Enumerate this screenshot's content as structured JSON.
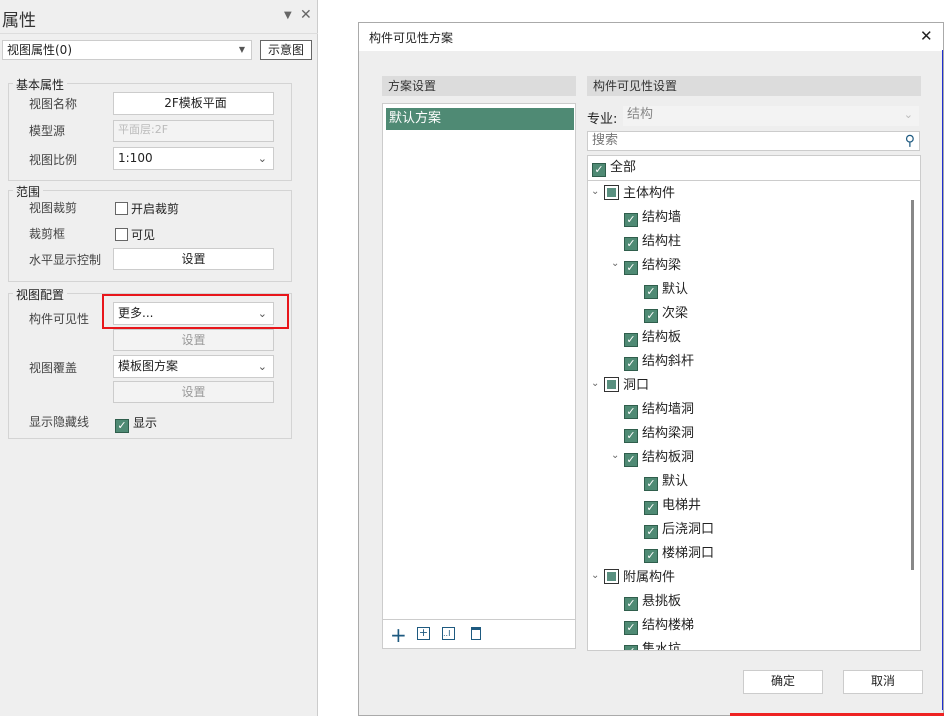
{
  "panel": {
    "title": "属性",
    "dropdown": "视图属性(0)",
    "preview_button": "示意图",
    "basic": {
      "title": "基本属性",
      "view_name_label": "视图名称",
      "view_name": "2F模板平面",
      "model_source_label": "模型源",
      "model_source": "平面层:2F",
      "scale_label": "视图比例",
      "scale": "1:100"
    },
    "range": {
      "title": "范围",
      "crop_label": "视图裁剪",
      "crop_check": "开启裁剪",
      "crop_box_label": "裁剪框",
      "crop_box_check": "可见",
      "horizontal_label": "水平显示控制",
      "horizontal_btn": "设置"
    },
    "config": {
      "title": "视图配置",
      "visibility_label": "构件可见性",
      "visibility_value": "更多...",
      "visibility_btn": "设置",
      "override_label": "视图覆盖",
      "override_value": "模板图方案",
      "override_btn": "设置",
      "hidden_label": "显示隐藏线",
      "hidden_check": "显示"
    }
  },
  "dialog": {
    "title": "构件可见性方案",
    "scheme_header": "方案设置",
    "schemes": [
      "默认方案"
    ],
    "visibility_header": "构件可见性设置",
    "discipline_label": "专业:",
    "discipline": "结构",
    "search_placeholder": "搜索",
    "all_label": "全部",
    "tree": [
      {
        "label": "主体构件",
        "level": 0,
        "state": "partial",
        "expand": true
      },
      {
        "label": "结构墙",
        "level": 1,
        "state": "checked"
      },
      {
        "label": "结构柱",
        "level": 1,
        "state": "checked"
      },
      {
        "label": "结构梁",
        "level": 1,
        "state": "checked",
        "expand": true
      },
      {
        "label": "默认",
        "level": 2,
        "state": "checked"
      },
      {
        "label": "次梁",
        "level": 2,
        "state": "checked"
      },
      {
        "label": "结构板",
        "level": 1,
        "state": "checked"
      },
      {
        "label": "结构斜杆",
        "level": 1,
        "state": "checked"
      },
      {
        "label": "洞口",
        "level": 0,
        "state": "partial",
        "expand": true
      },
      {
        "label": "结构墙洞",
        "level": 1,
        "state": "checked"
      },
      {
        "label": "结构梁洞",
        "level": 1,
        "state": "checked"
      },
      {
        "label": "结构板洞",
        "level": 1,
        "state": "checked",
        "expand": true
      },
      {
        "label": "默认",
        "level": 2,
        "state": "checked"
      },
      {
        "label": "电梯井",
        "level": 2,
        "state": "checked"
      },
      {
        "label": "后浇洞口",
        "level": 2,
        "state": "checked"
      },
      {
        "label": "楼梯洞口",
        "level": 2,
        "state": "checked"
      },
      {
        "label": "附属构件",
        "level": 0,
        "state": "partial",
        "expand": true
      },
      {
        "label": "悬挑板",
        "level": 1,
        "state": "checked"
      },
      {
        "label": "结构楼梯",
        "level": 1,
        "state": "checked"
      },
      {
        "label": "集水坑",
        "level": 1,
        "state": "checked"
      }
    ],
    "ok": "确定",
    "cancel": "取消"
  }
}
